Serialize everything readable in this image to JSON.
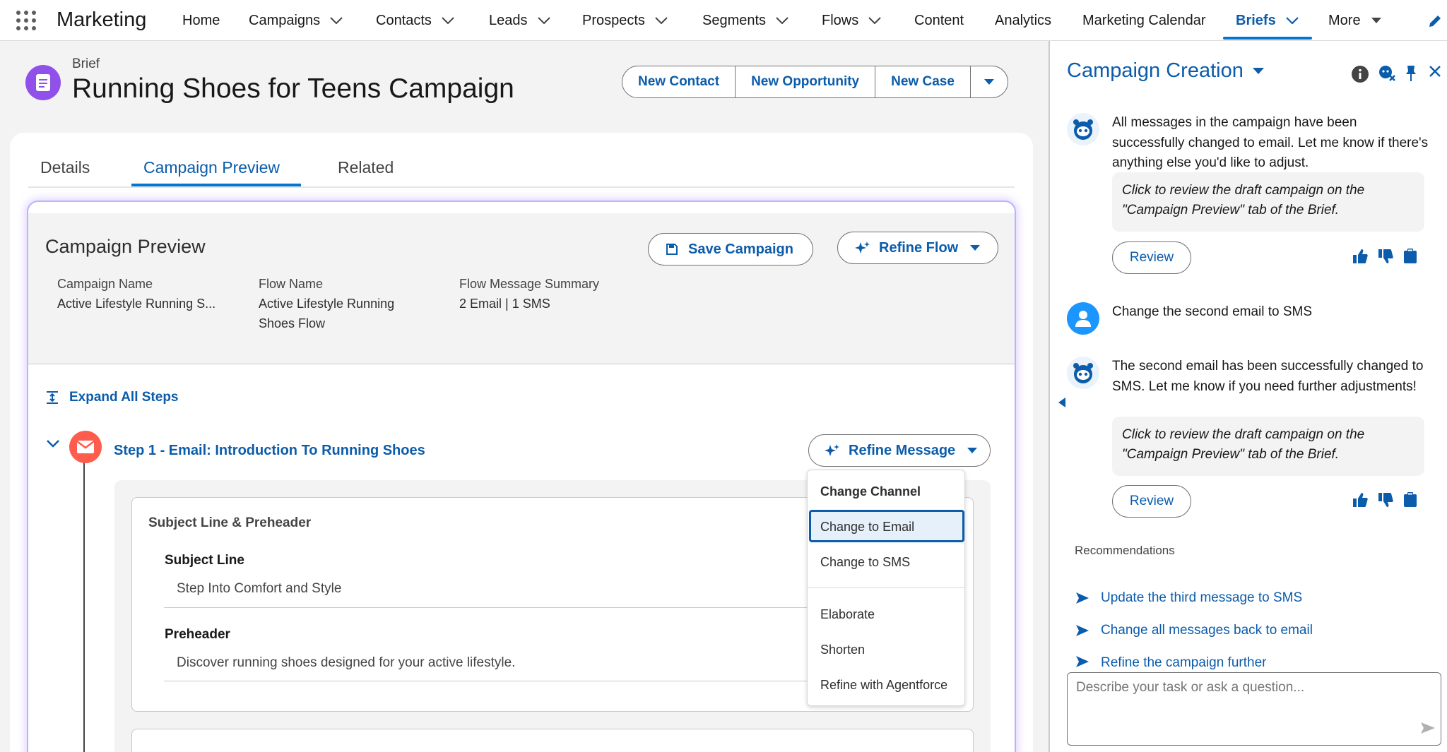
{
  "app": {
    "name": "Marketing"
  },
  "nav": {
    "items": [
      {
        "label": "Home",
        "has_menu": false
      },
      {
        "label": "Campaigns",
        "has_menu": true
      },
      {
        "label": "Contacts",
        "has_menu": true
      },
      {
        "label": "Leads",
        "has_menu": true
      },
      {
        "label": "Prospects",
        "has_menu": true
      },
      {
        "label": "Segments",
        "has_menu": true
      },
      {
        "label": "Flows",
        "has_menu": true
      },
      {
        "label": "Content",
        "has_menu": false
      },
      {
        "label": "Analytics",
        "has_menu": false
      },
      {
        "label": "Marketing Calendar",
        "has_menu": false
      },
      {
        "label": "Briefs",
        "has_menu": true,
        "active": true
      },
      {
        "label": "More",
        "has_menu": true
      }
    ]
  },
  "record": {
    "type_label": "Brief",
    "title": "Running Shoes for Teens Campaign",
    "actions": [
      "New Contact",
      "New Opportunity",
      "New Case"
    ]
  },
  "tabs": [
    {
      "label": "Details"
    },
    {
      "label": "Campaign Preview",
      "active": true
    },
    {
      "label": "Related"
    }
  ],
  "preview": {
    "title": "Campaign Preview",
    "save_label": "Save Campaign",
    "refine_flow_label": "Refine Flow",
    "fields": [
      {
        "label": "Campaign Name",
        "value": "Active Lifestyle Running S..."
      },
      {
        "label": "Flow Name",
        "value": "Active Lifestyle Running Shoes Flow"
      },
      {
        "label": "Flow Message Summary",
        "value": "2 Email | 1 SMS"
      }
    ],
    "expand_all_label": "Expand All Steps",
    "step": {
      "title": "Step 1 - Email: Introduction To Running Shoes",
      "refine_label": "Refine Message",
      "section_title": "Subject Line & Preheader",
      "subject_label": "Subject Line",
      "subject_value": "Step Into Comfort and Style",
      "preheader_label": "Preheader",
      "preheader_value": "Discover running shoes designed for your active lifestyle."
    }
  },
  "refine_menu": {
    "header": "Change Channel",
    "items": [
      "Change to Email",
      "Change to SMS",
      "Elaborate",
      "Shorten",
      "Refine with Agentforce"
    ],
    "selected": "Change to Email"
  },
  "panel": {
    "title": "Campaign Creation",
    "messages": [
      {
        "role": "agent",
        "text": "All messages in the campaign have been successfully changed to email. Let me know if there's anything else you'd like to adjust.",
        "quote": "Click to review the draft campaign on the \"Campaign Preview\" tab of the Brief.",
        "button": "Review"
      },
      {
        "role": "user",
        "text": "Change the second email to SMS"
      },
      {
        "role": "agent",
        "text": "The second email has been successfully changed to SMS. Let me know if you need further adjustments!",
        "quote": "Click to review the draft campaign on the \"Campaign Preview\" tab of the Brief.",
        "button": "Review"
      }
    ],
    "recommendations_label": "Recommendations",
    "recommendations": [
      "Update the third message to SMS",
      "Change all messages back to email",
      "Refine the campaign further"
    ],
    "input_placeholder": "Describe your task or ask a question..."
  },
  "colors": {
    "brand_blue": "#0b5cab",
    "accent": "#0176d3",
    "brief_icon": "#9050e9",
    "email_icon": "#fe5c4c"
  }
}
